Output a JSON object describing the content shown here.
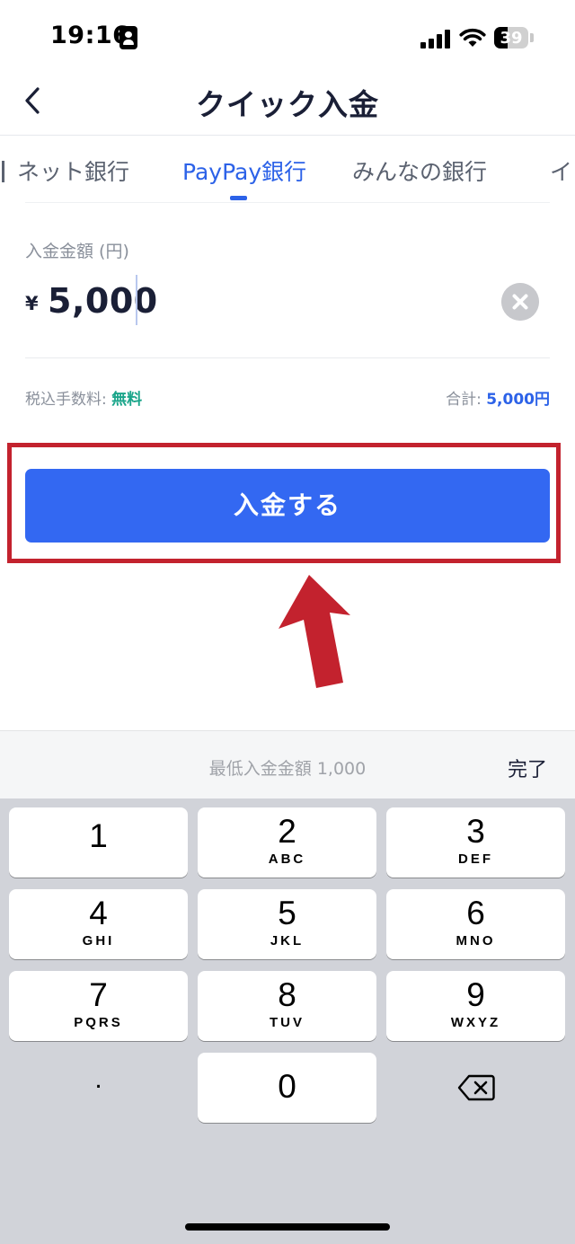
{
  "status_bar": {
    "time": "19:16",
    "battery": "39",
    "battery_level": 0.39
  },
  "header": {
    "title": "クイック入金",
    "back_icon": "chevron-left-icon"
  },
  "tabs": [
    {
      "label": "ネット銀行",
      "active": false
    },
    {
      "label": "PayPay銀行",
      "active": true
    },
    {
      "label": "みんなの銀行",
      "active": false
    },
    {
      "label": "イ",
      "active": false
    }
  ],
  "amount": {
    "label": "入金金額 (円)",
    "currency": "¥",
    "value": "5,000",
    "clear_icon": "clear-circle-icon"
  },
  "fee": {
    "label": "税込手数料: ",
    "value": "無料"
  },
  "total": {
    "label": "合計: ",
    "value": "5,000円"
  },
  "deposit_button": {
    "label": "入金する",
    "color": "#3368f2"
  },
  "annotation": {
    "highlight_color": "#c3222e"
  },
  "keyboard": {
    "min_amount": "最低入金金額 1,000",
    "done": "完了",
    "keys": [
      {
        "num": "1",
        "letters": ""
      },
      {
        "num": "2",
        "letters": "ABC"
      },
      {
        "num": "3",
        "letters": "DEF"
      },
      {
        "num": "4",
        "letters": "GHI"
      },
      {
        "num": "5",
        "letters": "JKL"
      },
      {
        "num": "6",
        "letters": "MNO"
      },
      {
        "num": "7",
        "letters": "PQRS"
      },
      {
        "num": "8",
        "letters": "TUV"
      },
      {
        "num": "9",
        "letters": "WXYZ"
      },
      {
        "num": "0",
        "letters": ""
      }
    ],
    "dot": ".",
    "delete_icon": "backspace-icon"
  }
}
